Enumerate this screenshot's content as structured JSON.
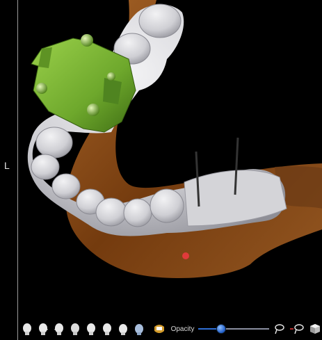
{
  "viewport": {
    "orientation_label": "L"
  },
  "toolbar": {
    "view_buttons": [
      "head-front-icon",
      "head-right-icon",
      "head-left-icon",
      "head-back-icon",
      "head-top-icon",
      "head-bottom-icon",
      "head-oblique-icon",
      "head-mask-icon"
    ],
    "teeth_toggle_icon": "teeth-icon",
    "opacity_label": "Opacity",
    "opacity_value": 0.3,
    "tools": [
      "lasso-icon",
      "lasso-remove-icon",
      "cube-icon"
    ]
  },
  "colors": {
    "bone": "#8a4a12",
    "teeth": "#d8d8dc",
    "guide": "#6fae2a",
    "slider_thumb": "#2f6fd6"
  }
}
